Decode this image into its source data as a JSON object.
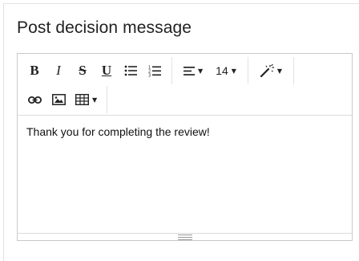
{
  "section": {
    "title": "Post decision message"
  },
  "toolbar": {
    "bold_label": "B",
    "italic_label": "I",
    "strike_label": "S",
    "underline_label": "U",
    "bullet_list_icon": "bullet-list-icon",
    "numbered_list_icon": "numbered-list-icon",
    "align_icon": "align-left-icon",
    "font_size": "14",
    "magic_icon": "magic-wand-icon",
    "link_icon": "link-icon",
    "image_icon": "image-icon",
    "table_icon": "table-icon"
  },
  "editor": {
    "content": "Thank you for completing the review!"
  }
}
